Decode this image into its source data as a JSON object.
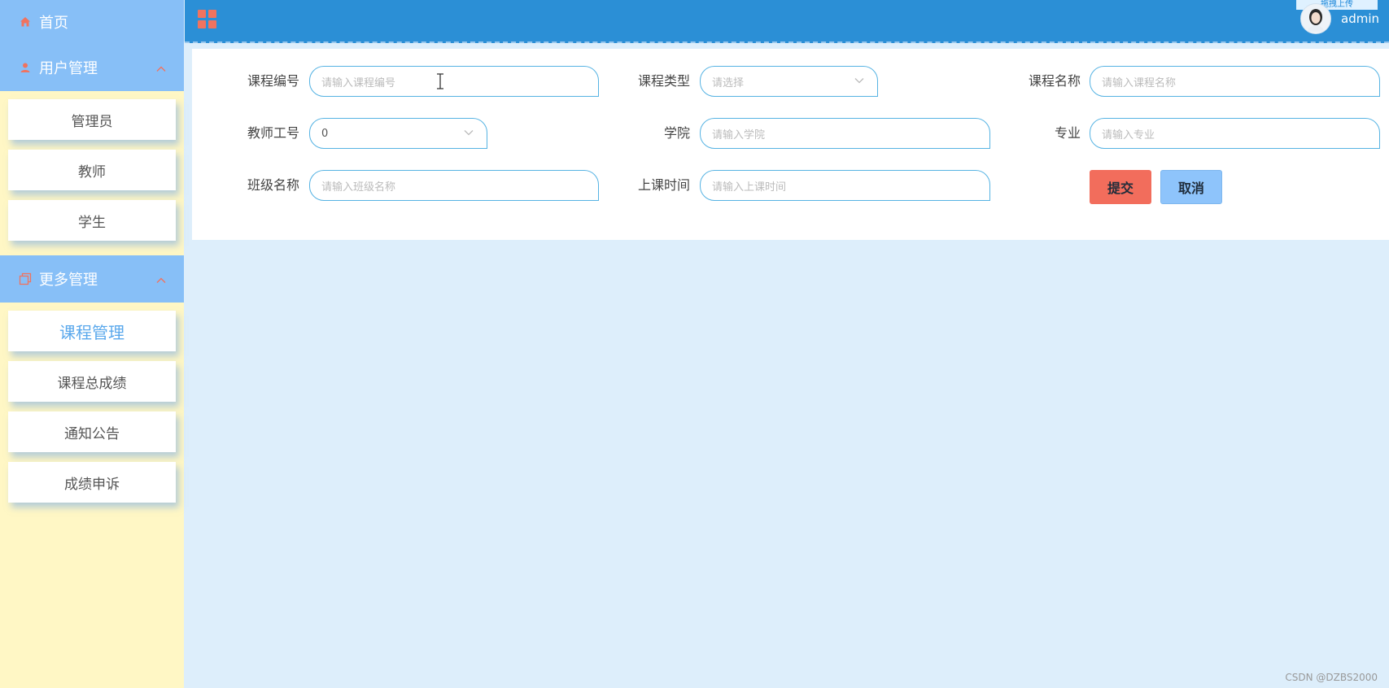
{
  "sidebar": {
    "home": {
      "label": "首页",
      "icon": "home-icon"
    },
    "user_group": {
      "label": "用户管理",
      "icon": "person-icon",
      "items": [
        {
          "label": "管理员"
        },
        {
          "label": "教师"
        },
        {
          "label": "学生"
        }
      ]
    },
    "more_group": {
      "label": "更多管理",
      "icon": "copy-icon",
      "items": [
        {
          "label": "课程管理",
          "active": true
        },
        {
          "label": "课程总成绩"
        },
        {
          "label": "通知公告"
        },
        {
          "label": "成绩申诉"
        }
      ]
    }
  },
  "topbar": {
    "menu_icon": "grid-icon",
    "username": "admin",
    "corner_text": "拖拽上传"
  },
  "form": {
    "course_no": {
      "label": "课程编号",
      "placeholder": "请输入课程编号"
    },
    "course_type": {
      "label": "课程类型",
      "placeholder": "请选择"
    },
    "course_name": {
      "label": "课程名称",
      "placeholder": "请输入课程名称"
    },
    "teacher_no": {
      "label": "教师工号",
      "value": "0"
    },
    "college": {
      "label": "学院",
      "placeholder": "请输入学院"
    },
    "major": {
      "label": "专业",
      "placeholder": "请输入专业"
    },
    "class_name": {
      "label": "班级名称",
      "placeholder": "请输入班级名称"
    },
    "class_time": {
      "label": "上课时间",
      "placeholder": "请输入上课时间"
    },
    "submit_label": "提交",
    "cancel_label": "取消"
  },
  "watermark": "CSDN @DZBS2000",
  "colors": {
    "topbar": "#2b8fd6",
    "sidebar_head": "#87bff7",
    "sidebar_bg": "#fff7c5",
    "content_bg": "#ddeefb",
    "accent": "#f0735f",
    "active_text": "#5aa8ec"
  }
}
